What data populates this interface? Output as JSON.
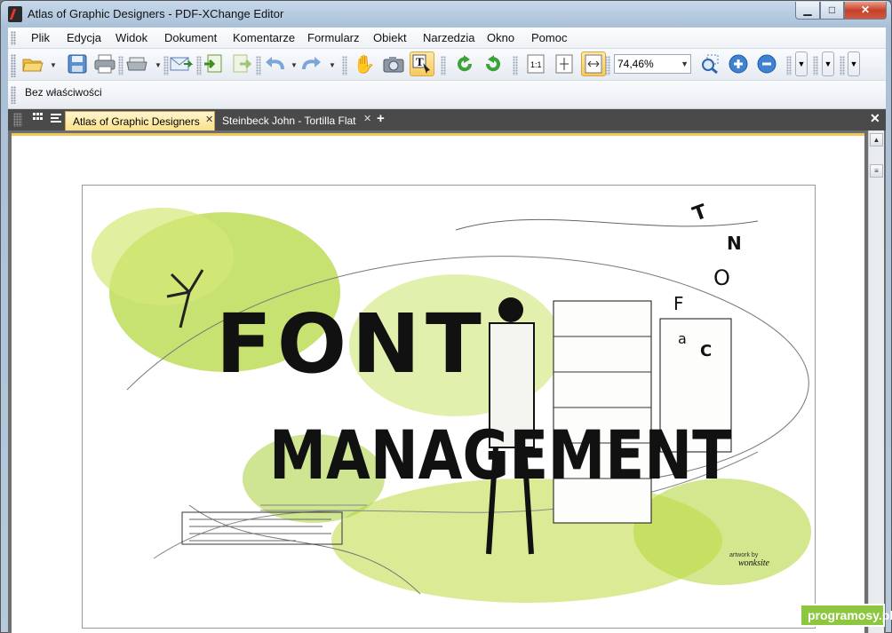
{
  "window": {
    "title": "Atlas of Graphic Designers - PDF-XChange Editor",
    "controls": {
      "minimize": "▁",
      "maximize": "□",
      "close": "✕"
    }
  },
  "menu": {
    "items": [
      "Plik",
      "Edycja",
      "Widok",
      "Dokument",
      "Komentarze",
      "Formularz",
      "Obiekt",
      "Narzedzia",
      "Okno",
      "Pomoc"
    ]
  },
  "toolbar": {
    "zoom_value": "74,46%",
    "icons": [
      "open-folder-icon",
      "save-icon",
      "print-icon",
      "scanner-icon",
      "email-icon",
      "import-icon",
      "export-icon",
      "undo-icon",
      "redo-icon",
      "hand-tool-icon",
      "snapshot-icon",
      "select-text-icon",
      "rotate-left-icon",
      "rotate-right-icon",
      "actual-size-icon",
      "fit-page-icon",
      "fit-width-icon",
      "zoom-marquee-icon",
      "zoom-in-icon",
      "zoom-out-icon"
    ]
  },
  "properties": {
    "label": "Bez właściwości"
  },
  "tabs": [
    {
      "label": "Atlas of Graphic Designers",
      "active": true
    },
    {
      "label": "Steinbeck John - Tortilla Flat",
      "active": false
    }
  ],
  "artwork": {
    "title_line1": "FONT",
    "title_line2": "MANAGEMENT",
    "credit_small": "artwork by",
    "credit_name": "wonksite",
    "letters": [
      "T",
      "N",
      "O",
      "F",
      "C",
      "a"
    ]
  },
  "watermark": {
    "text": "programosy.pl"
  },
  "colors": {
    "accent_tab": "#fbe08a",
    "splash_green": "#b6d842",
    "watermark": "#8dc63f"
  }
}
